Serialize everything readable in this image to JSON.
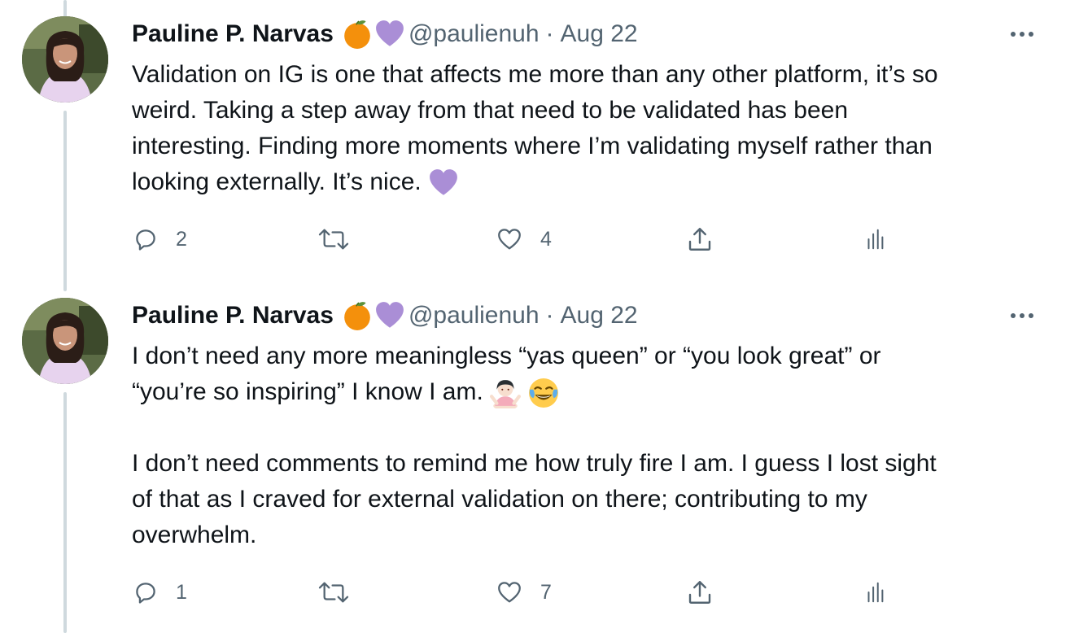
{
  "tweets": [
    {
      "author_name": "Pauline P. Narvas",
      "author_emojis": [
        "orange-emoji",
        "purple-heart-emoji"
      ],
      "handle": "@paulienuh",
      "separator": "·",
      "date": "Aug 22",
      "lines": [
        "Validation on IG is one that affects me more than any other platform, it’s so",
        "weird. Taking a step away from that need to be validated has been",
        "interesting. Finding more moments where I’m validating myself rather than",
        "looking externally. It’s nice."
      ],
      "trailing_emoji": "purple-heart-emoji",
      "reply_count": "2",
      "retweet_count": "",
      "like_count": "4"
    },
    {
      "author_name": "Pauline P. Narvas",
      "author_emojis": [
        "orange-emoji",
        "purple-heart-emoji"
      ],
      "handle": "@paulienuh",
      "separator": "·",
      "date": "Aug 22",
      "lines": [
        "I don’t need any more meaningless “yas queen” or “you look great” or",
        "“you’re so inspiring” I know I am.",
        "",
        "I don’t need comments to remind me how truly fire I am. I guess I lost sight",
        "of that as I craved for external validation on there; contributing to my",
        "overwhelm."
      ],
      "line2_emojis": [
        "woman-shrugging-emoji",
        "tears-of-joy-emoji"
      ],
      "reply_count": "1",
      "retweet_count": "",
      "like_count": "7"
    }
  ],
  "icons": {
    "reply": "reply-icon",
    "retweet": "retweet-icon",
    "like": "heart-icon",
    "share": "share-icon",
    "analytics": "analytics-icon",
    "more": "more-icon"
  },
  "colors": {
    "text": "#0f1419",
    "secondary": "#536471",
    "thread_line": "#cfd9de",
    "orange": "#f4900c",
    "purple_heart": "#aa8ed6"
  }
}
